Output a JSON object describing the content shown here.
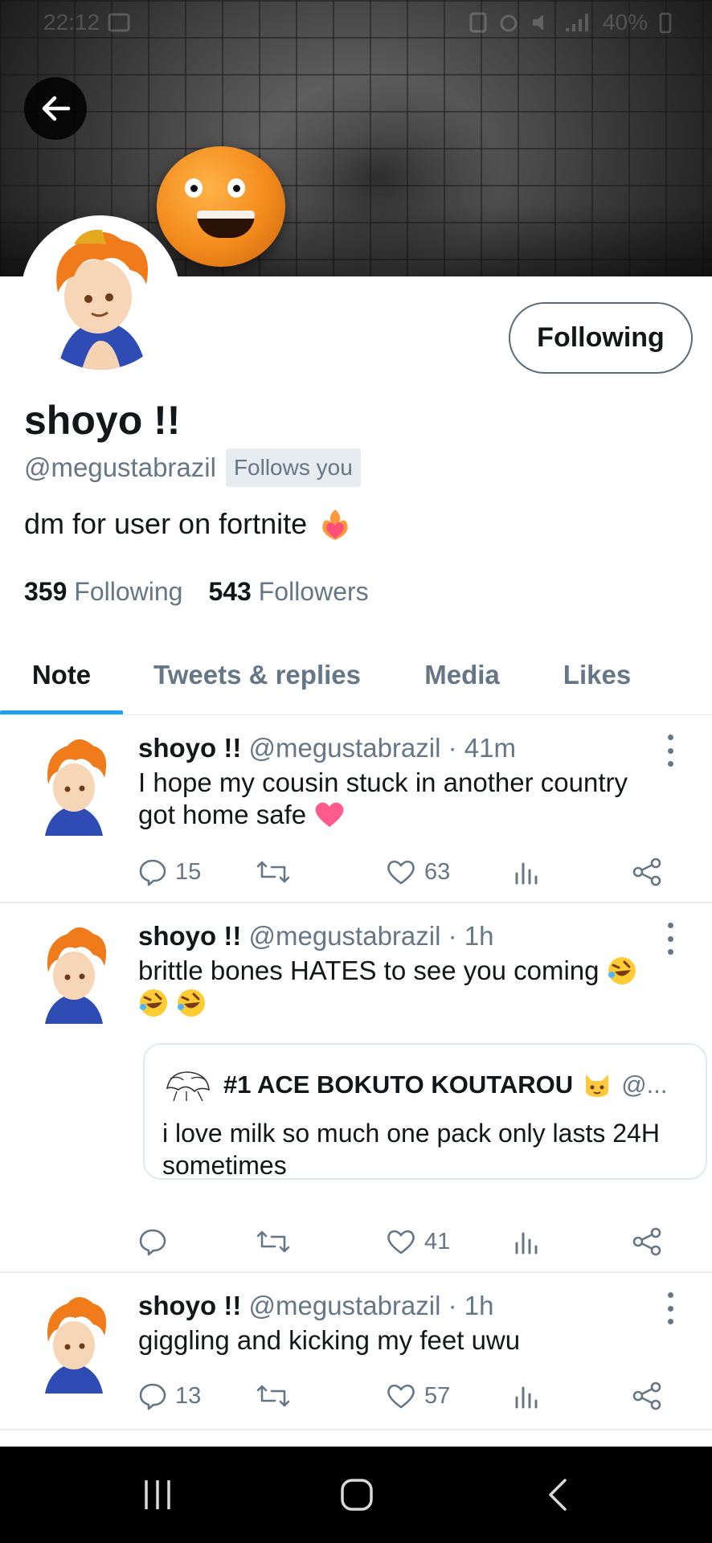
{
  "status_bar": {
    "time": "22:12",
    "battery": "40%"
  },
  "colors": {
    "accent": "#1da1f2",
    "secondary_text": "#657786",
    "like_heart": "#e0245e"
  },
  "profile": {
    "display_name": "shoyo !!",
    "handle": "@megustabrazil",
    "follows_you": "Follows you",
    "bio": "dm for user on fortnite",
    "bio_emoji": "heart-on-fire-emoji",
    "following_count": "359",
    "following_label": "Following",
    "followers_count": "543",
    "followers_label": "Followers",
    "follow_button_label": "Following"
  },
  "tabs": [
    {
      "label": "Note",
      "active": true
    },
    {
      "label": "Tweets & replies",
      "active": false
    },
    {
      "label": "Media",
      "active": false
    },
    {
      "label": "Likes",
      "active": false
    }
  ],
  "tweets": [
    {
      "name": "shoyo !!",
      "handle": "@megustabrazil",
      "time": "41m",
      "text": "I hope my cousin stuck in another country got home safe",
      "emoji": "pink-heart-emoji",
      "replies": "15",
      "retweets": "",
      "likes": "63"
    },
    {
      "name": "shoyo !!",
      "handle": "@megustabrazil",
      "time": "1h",
      "text": "brittle bones HATES to see you coming",
      "emoji": "rolling-laughing-emoji",
      "replies": "",
      "retweets": "",
      "likes": "41",
      "quote": {
        "name": "#1 ACE BOKUTO KOUTAROU",
        "name_emoji": "cat-emoji",
        "handle": "@...",
        "text": "i love milk so much one pack only lasts 24H sometimes"
      }
    },
    {
      "name": "shoyo !!",
      "handle": "@megustabrazil",
      "time": "1h",
      "text": "giggling and kicking my feet uwu",
      "replies": "13",
      "retweets": "",
      "likes": "57"
    }
  ],
  "separator": " · "
}
